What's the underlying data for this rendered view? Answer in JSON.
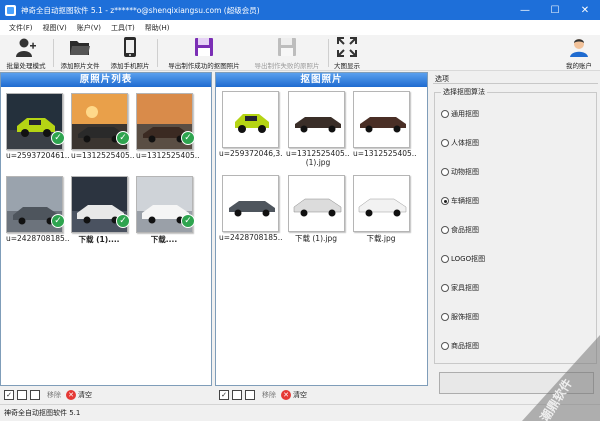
{
  "window": {
    "title": "神奇全自动抠图软件 5.1 - z******o@shenqixiangsu.com (超级会员)",
    "controls": {
      "minimize": "—",
      "maximize": "☐",
      "close": "✕"
    }
  },
  "menu": [
    "文件(F)",
    "视图(V)",
    "账户(V)",
    "工具(T)",
    "帮助(H)"
  ],
  "toolbar": {
    "batch": "批量处理模式",
    "add_file": "添加照片文件",
    "add_phone": "添加手机照片",
    "export_success": "导出制作成功的抠图照片",
    "export_fail": "导出制作失败的原照片",
    "fullscreen": "大图显示",
    "account": "我的账户"
  },
  "left_panel": {
    "title": "原照片列表",
    "captions": [
      "u=2593720461...",
      "u=1312525405...",
      "u=1312525405...",
      "u=2428708185...",
      "下载 (1)....",
      "下载...."
    ]
  },
  "mid_panel": {
    "title": "抠图照片",
    "captions": [
      "u=259372046,3...",
      "u=1312525405...",
      "u=1312525405...",
      "u=2428708185...",
      "下载 (1).jpg",
      "下载.jpg"
    ],
    "captions_line2": [
      "",
      "(1).jpg",
      "",
      "",
      "",
      ""
    ]
  },
  "bottom": {
    "delete": "移除",
    "clear": "清空"
  },
  "options": {
    "title": "选项",
    "group_title": "选择抠图算法",
    "algorithms": [
      "通用抠图",
      "人体抠图",
      "动物抠图",
      "车辆抠图",
      "食品抠图",
      "LOGO抠图",
      "家具抠图",
      "服饰抠图",
      "商品抠图"
    ],
    "selected": "车辆抠图"
  },
  "status": "神奇全自动抠图软件 5.1",
  "watermark": "潮鼎软件"
}
